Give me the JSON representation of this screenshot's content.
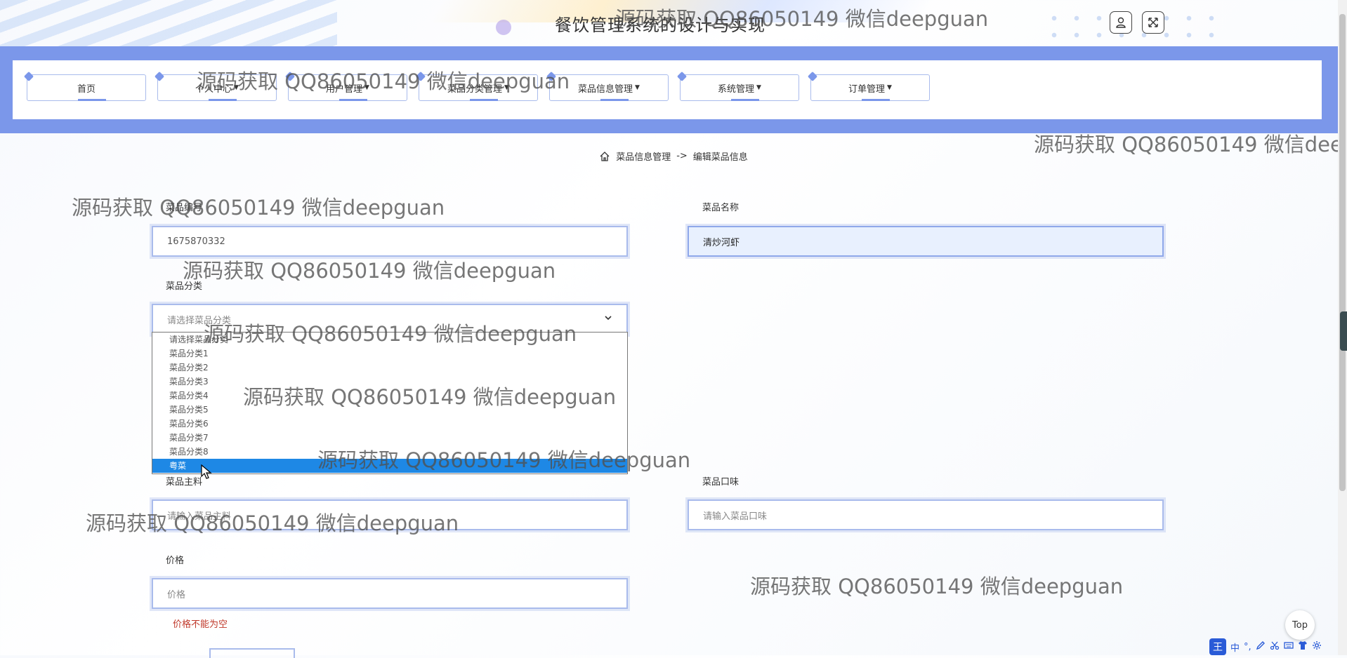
{
  "app_title": "餐饮管理系统的设计与实现",
  "top_icons": [
    "user-icon",
    "fullscreen-icon"
  ],
  "nav": {
    "items": [
      {
        "label": "首页",
        "has_caret": false
      },
      {
        "label": "个人中心",
        "has_caret": true
      },
      {
        "label": "用户管理",
        "has_caret": true
      },
      {
        "label": "菜品分类管理",
        "has_caret": true
      },
      {
        "label": "菜品信息管理",
        "has_caret": true
      },
      {
        "label": "系统管理",
        "has_caret": true
      },
      {
        "label": "订单管理",
        "has_caret": true
      }
    ]
  },
  "breadcrumb": {
    "section": "菜品信息管理",
    "separator": "->",
    "page": "编辑菜品信息"
  },
  "form": {
    "dish_id_label": "菜品编号",
    "dish_id_value": "1675870332",
    "dish_name_label": "菜品名称",
    "dish_name_value": "清炒河虾",
    "category_label": "菜品分类",
    "category_placeholder": "请选择菜品分类",
    "category_options": [
      "请选择菜品分类",
      "菜品分类1",
      "菜品分类2",
      "菜品分类3",
      "菜品分类4",
      "菜品分类5",
      "菜品分类6",
      "菜品分类7",
      "菜品分类8",
      "粤菜"
    ],
    "category_highlighted": "粤菜",
    "main_ingredient_label": "菜品主料",
    "main_ingredient_placeholder": "请输入菜品主料",
    "taste_label": "菜品口味",
    "taste_placeholder": "请输入菜品口味",
    "price_label": "价格",
    "price_placeholder": "价格",
    "price_error": "价格不能为空"
  },
  "top_button_label": "Top",
  "ime": {
    "logo": "王",
    "mode": "中",
    "extra": "°,"
  },
  "watermark_text": "源码获取 QQ86050149 微信deepguan",
  "colors": {
    "nav_band": "#7b97ea",
    "border": "#a9bbec",
    "selected": "#1e88e5",
    "error": "#c0392b"
  }
}
